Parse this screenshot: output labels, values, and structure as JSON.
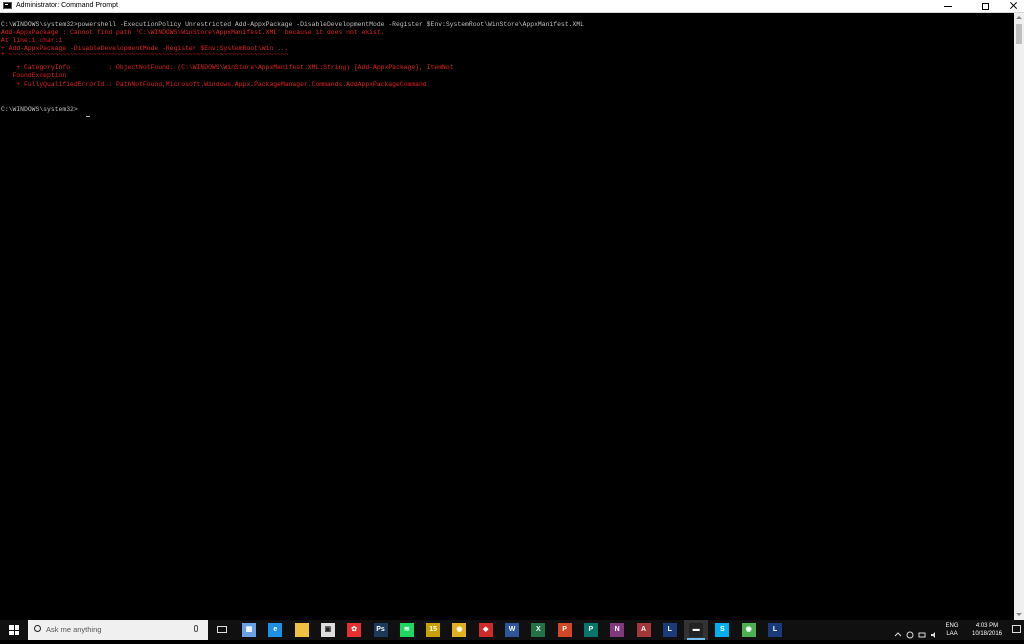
{
  "window": {
    "title": "Administrator: Command Prompt"
  },
  "console": {
    "lines": [
      "C:\\WINDOWS\\system32>powershell -ExecutionPolicy Unrestricted Add-AppxPackage -DisableDevelopmentMode -Register $Env:SystemRoot\\WinStore\\AppxManifest.XML",
      "Add-AppxPackage : Cannot find path 'C:\\WINDOWS\\WinStore\\AppxManifest.XML' because it does not exist.",
      "At line:1 char:1",
      "+ Add-AppxPackage -DisableDevelopmentMode -Register $Env:SystemRoot\\Win ...",
      "+ ~~~~~~~~~~~~~~~~~~~~~~~~~~~~~~~~~~~~~~~~~~~~~~~~~~~~~~~~~~~~~~~~~~~~~~~~~",
      "    + CategoryInfo          : ObjectNotFound: (C:\\WINDOWS\\WinStore\\AppxManifest.XML:String) [Add-AppxPackage], ItemNot",
      "   FoundException",
      "    + FullyQualifiedErrorId : PathNotFound,Microsoft.Windows.Appx.PackageManager.Commands.AddAppxPackageCommand",
      "",
      "",
      "C:\\WINDOWS\\system32>"
    ]
  },
  "taskbar": {
    "search_placeholder": "Ask me anything",
    "apps": [
      {
        "name": "taskbar-item-calculator",
        "icon": "calculator-icon",
        "color": "#6aa0e8",
        "glyph": "▦"
      },
      {
        "name": "taskbar-item-edge",
        "icon": "edge-icon",
        "color": "#1e90e6",
        "glyph": "e"
      },
      {
        "name": "taskbar-item-file-explorer",
        "icon": "folder-icon",
        "color": "#f0c040",
        "glyph": ""
      },
      {
        "name": "taskbar-item-store",
        "icon": "store-icon",
        "color": "#ffffff",
        "glyph": "▣"
      },
      {
        "name": "taskbar-item-app-red",
        "icon": "app-red-icon",
        "color": "#e83030",
        "glyph": "✿"
      },
      {
        "name": "taskbar-item-photoshop",
        "icon": "photoshop-icon",
        "color": "#1a3a5a",
        "glyph": "Ps"
      },
      {
        "name": "taskbar-item-spotify",
        "icon": "spotify-icon",
        "color": "#1ed760",
        "glyph": "≋"
      },
      {
        "name": "taskbar-item-app-15",
        "icon": "calendar-icon",
        "color": "#c8a000",
        "glyph": "15"
      },
      {
        "name": "taskbar-item-chrome",
        "icon": "chrome-icon",
        "color": "#e0b020",
        "glyph": "◉"
      },
      {
        "name": "taskbar-item-app-red-2",
        "icon": "app-red-2-icon",
        "color": "#d02a2a",
        "glyph": "◆"
      },
      {
        "name": "taskbar-item-word",
        "icon": "word-icon",
        "color": "#2b579a",
        "glyph": "W"
      },
      {
        "name": "taskbar-item-excel",
        "icon": "excel-icon",
        "color": "#217346",
        "glyph": "X"
      },
      {
        "name": "taskbar-item-powerpoint",
        "icon": "powerpoint-icon",
        "color": "#d24726",
        "glyph": "P"
      },
      {
        "name": "taskbar-item-publisher",
        "icon": "publisher-icon",
        "color": "#077568",
        "glyph": "P"
      },
      {
        "name": "taskbar-item-onenote",
        "icon": "onenote-icon",
        "color": "#80397b",
        "glyph": "N"
      },
      {
        "name": "taskbar-item-access",
        "icon": "access-icon",
        "color": "#a4373a",
        "glyph": "A"
      },
      {
        "name": "taskbar-item-app-l",
        "icon": "app-l-icon",
        "color": "#1a3a7a",
        "glyph": "L"
      },
      {
        "name": "taskbar-item-command-prompt",
        "icon": "command-prompt-icon",
        "color": "#222222",
        "glyph": "▬"
      },
      {
        "name": "taskbar-item-skype",
        "icon": "skype-icon",
        "color": "#00aff0",
        "glyph": "S"
      },
      {
        "name": "taskbar-item-chrome-2",
        "icon": "chrome-2-icon",
        "color": "#4caf50",
        "glyph": "◉"
      },
      {
        "name": "taskbar-item-app-l-2",
        "icon": "app-l-2-icon",
        "color": "#1a3a7a",
        "glyph": "L"
      }
    ],
    "language": {
      "line1": "ENG",
      "line2": "LAA"
    },
    "clock": {
      "time": "4:03 PM",
      "date": "10/18/2016"
    }
  }
}
